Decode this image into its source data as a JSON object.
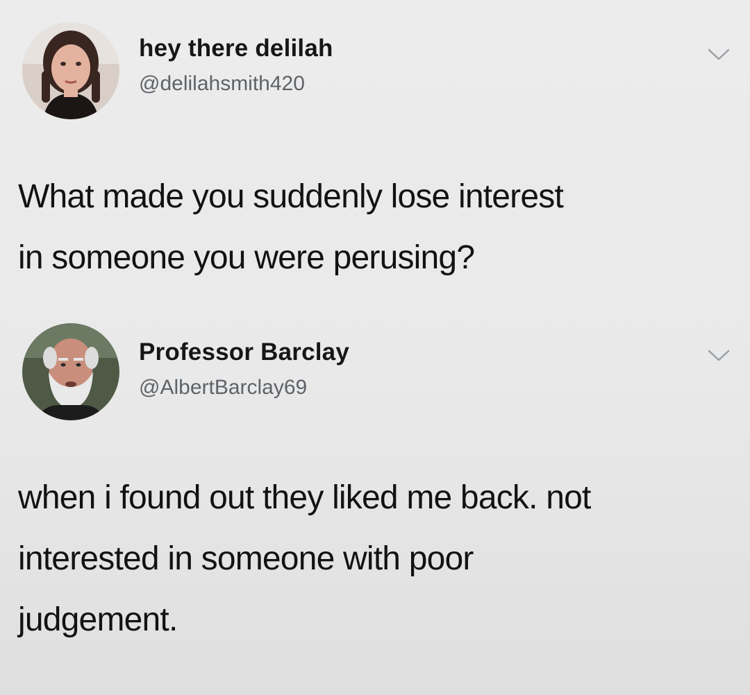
{
  "tweets": [
    {
      "display_name": "hey there delilah",
      "handle": "@delilahsmith420",
      "avatar_icon": "avatar-photo-woman",
      "menu_icon": "chevron-down-icon",
      "text_lines": [
        "What made you suddenly lose interest",
        "in someone you were perusing?"
      ]
    },
    {
      "display_name": "Professor Barclay",
      "handle": "@AlbertBarclay69",
      "avatar_icon": "avatar-photo-old-man",
      "menu_icon": "chevron-down-icon",
      "text_lines": [
        "when i found out they liked me back. not",
        "interested in someone with poor",
        "judgement."
      ]
    }
  ],
  "colors": {
    "background": "#ececec",
    "text": "#121212",
    "handle": "#5e6368",
    "chevron": "#9aa0a6"
  }
}
